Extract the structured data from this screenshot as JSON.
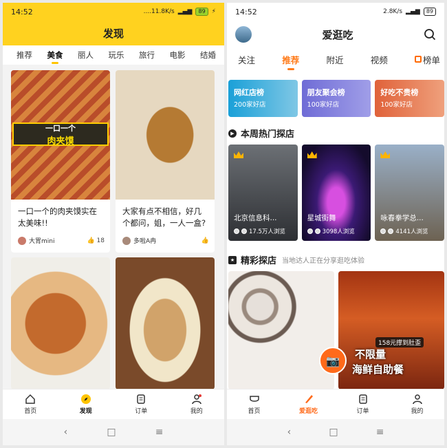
{
  "left": {
    "status": {
      "time": "14:52",
      "net": "....11.8K/s",
      "battery": "89"
    },
    "title": "发现",
    "categories": [
      "推荐",
      "美食",
      "丽人",
      "玩乐",
      "旅行",
      "电影",
      "结婚"
    ],
    "cards": [
      {
        "banner_top": "一口一个",
        "banner_main": "肉夹馍",
        "title": "一口一个的肉夹馍实在太美味!!",
        "user": "大胃mini",
        "likes": "18"
      },
      {
        "title": "大家有点不相信，好几个都问，姐，一人一盒?",
        "user": "多啦A冉",
        "likes": ""
      },
      {
        "title": ""
      },
      {
        "title": ""
      }
    ],
    "tabs": [
      "首页",
      "发现",
      "订单",
      "我的"
    ]
  },
  "right": {
    "status": {
      "time": "14:52",
      "net": "2.8K/s",
      "battery": "89"
    },
    "title": "爱逛吃",
    "tabs": [
      "关注",
      "推荐",
      "附近",
      "视频",
      "榜单"
    ],
    "rank_cards": [
      {
        "name": "网红店榜",
        "sub": "200家好店"
      },
      {
        "name": "朋友聚会榜",
        "sub": "100家好店"
      },
      {
        "name": "好吃不贵榜",
        "sub": "100家好店"
      }
    ],
    "hot_section": {
      "title": "本周热门探店"
    },
    "hot": [
      {
        "name": "北京信息科...",
        "views": "17.5万人浏览"
      },
      {
        "name": "星城街舞",
        "views": "3098人浏览"
      },
      {
        "name": "咏春拳学总...",
        "views": "4141人浏览"
      }
    ],
    "feat_section": {
      "title": "精彩探店",
      "sub": "当地达人正在分享逛吃体验"
    },
    "featured": {
      "price": "158元撑到肚歪",
      "line1": "不限量",
      "line2": "海鲜自助餐"
    },
    "bottom_tabs": [
      "首页",
      "爱逛吃",
      "订单",
      "我的"
    ]
  },
  "colors": {
    "left_accent": "#ffd21f",
    "right_accent": "#ff7b1a"
  }
}
